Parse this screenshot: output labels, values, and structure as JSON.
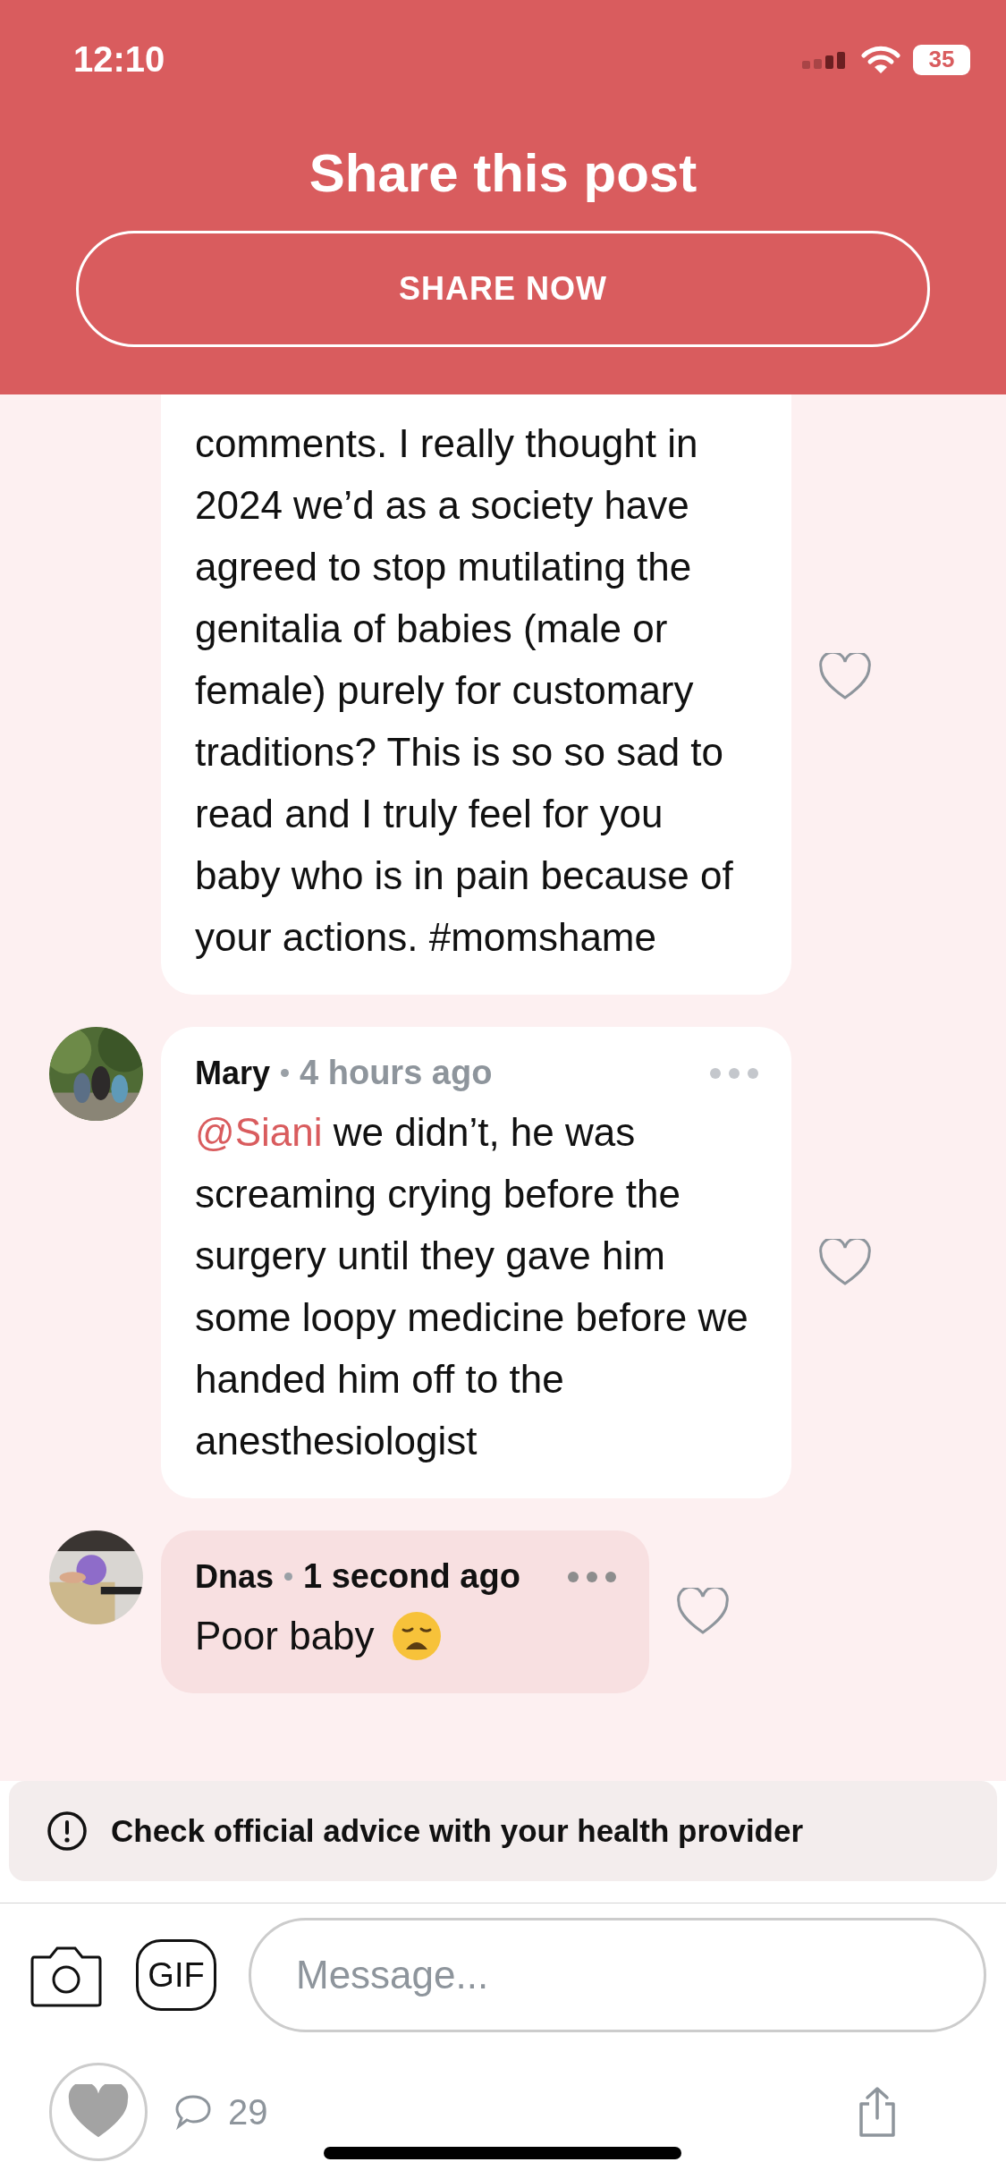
{
  "status_bar": {
    "time": "12:10",
    "battery": "35"
  },
  "header": {
    "title": "Share this post",
    "button": "SHARE NOW"
  },
  "comments": [
    {
      "kind": "other",
      "text": "comments. I really thought in 2024 we’d as a society have agreed to stop mutilating the genitalia of babies (male or female) purely for customary traditions? This is so so sad to read and I truly feel for you baby who is in pain because of your actions. #momshame"
    },
    {
      "kind": "other",
      "author": "Mary",
      "time": "4 hours ago",
      "mention": "@Siani",
      "text": "we didn’t, he was screaming crying before the surgery until they gave him some loopy medicine before we handed him off to the anesthesiologist"
    },
    {
      "kind": "own",
      "author": "Dnas",
      "time": "1 second ago",
      "text": "Poor baby",
      "emoji": true
    }
  ],
  "advice": "Check official advice with your health provider",
  "composer": {
    "placeholder": "Message...",
    "gif": "GIF"
  },
  "footer": {
    "comment_count": "29"
  }
}
